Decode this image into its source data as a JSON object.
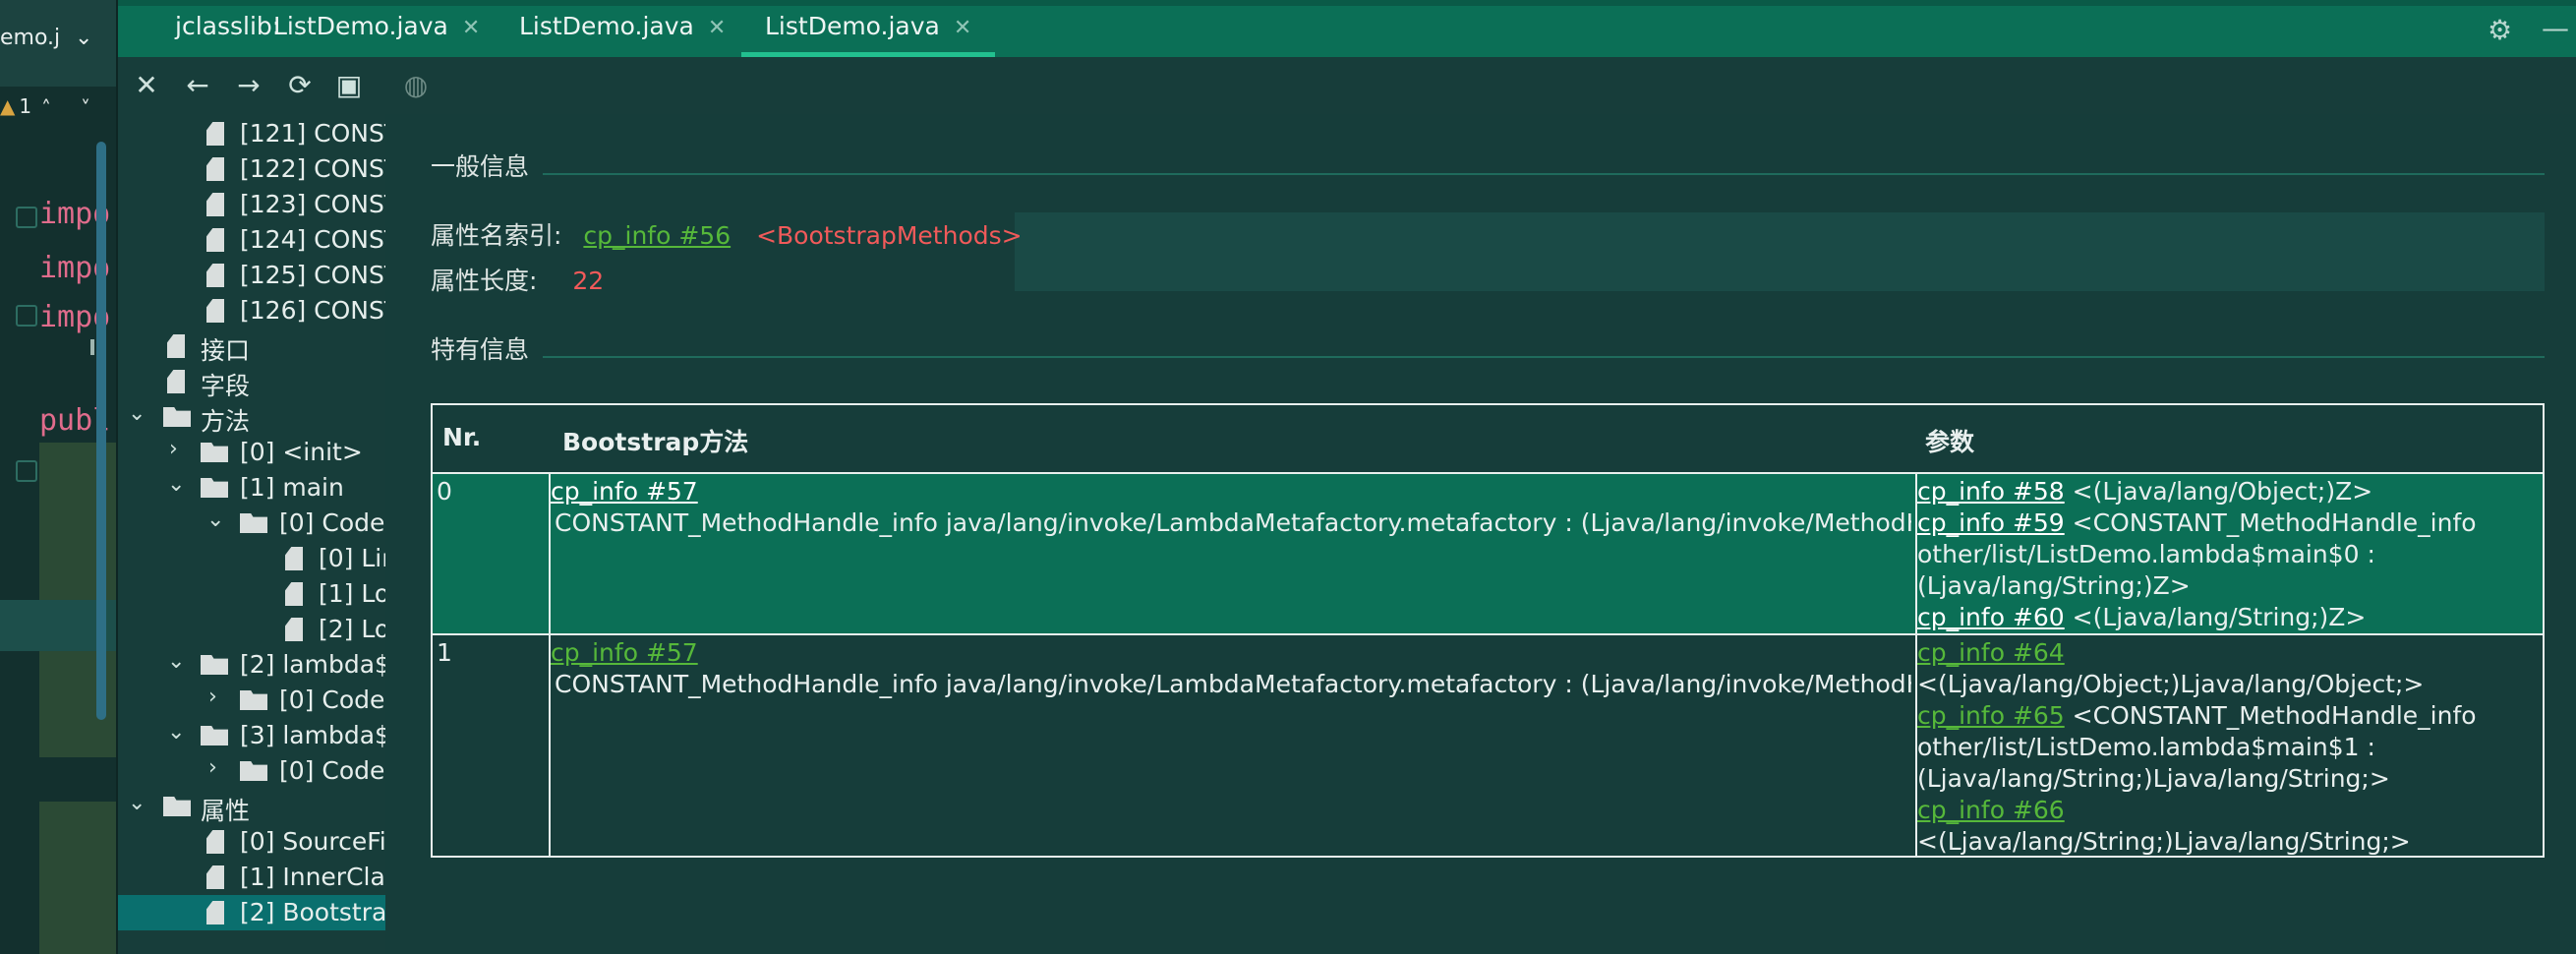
{
  "editor": {
    "file_tab": "emo.j",
    "warning_count": "1",
    "code_lines": [
      "impo",
      "impo",
      "impo",
      "publ"
    ]
  },
  "tabs": {
    "prefix": "jclasslib:",
    "items": [
      {
        "label": "ListDemo.java"
      },
      {
        "label": "ListDemo.java"
      },
      {
        "label": "ListDemo.java"
      }
    ]
  },
  "tree": {
    "items": [
      {
        "label": "[121] CONST"
      },
      {
        "label": "[122] CONST"
      },
      {
        "label": "[123] CONST"
      },
      {
        "label": "[124] CONST"
      },
      {
        "label": "[125] CONST"
      },
      {
        "label": "[126] CONST"
      },
      {
        "label": "接口"
      },
      {
        "label": "字段"
      },
      {
        "label": "方法"
      },
      {
        "label": "[0] <init>"
      },
      {
        "label": "[1] main"
      },
      {
        "label": "[0] Code"
      },
      {
        "label": "[0] Lin"
      },
      {
        "label": "[1] Lo"
      },
      {
        "label": "[2] Lo"
      },
      {
        "label": "[2] lambda$"
      },
      {
        "label": "[0] Code"
      },
      {
        "label": "[3] lambda$"
      },
      {
        "label": "[0] Code"
      },
      {
        "label": "属性"
      },
      {
        "label": "[0] SourceFi"
      },
      {
        "label": "[1] InnerClas"
      },
      {
        "label": "[2] Bootstra"
      }
    ]
  },
  "general": {
    "title": "一般信息",
    "name_index_label": "属性名索引:",
    "name_index_link": "cp_info #56",
    "name_index_value": "<BootstrapMethods>",
    "length_label": "属性长度:",
    "length_value": "22"
  },
  "specific": {
    "title": "特有信息",
    "headers": [
      "Nr.",
      "Bootstrap方法",
      "参数"
    ],
    "rows": [
      {
        "nr": "0",
        "method_link": "cp_info #57",
        "method_desc": "CONSTANT_MethodHandle_info java/lang/invoke/LambdaMetafactory.metafactory : (Ljava/lang/invoke/MethodHandles$Lookup;",
        "args": [
          {
            "link": "cp_info #58",
            "text": "<(Ljava/lang/Object;)Z>"
          },
          {
            "link": "cp_info #59",
            "text": "<CONSTANT_MethodHandle_info"
          },
          {
            "link": "",
            "text": "other/list/ListDemo.lambda$main$0 :"
          },
          {
            "link": "",
            "text": "(Ljava/lang/String;)Z>"
          },
          {
            "link": "cp_info #60",
            "text": "<(Ljava/lang/String;)Z>"
          }
        ]
      },
      {
        "nr": "1",
        "method_link": "cp_info #57",
        "method_desc": "CONSTANT_MethodHandle_info java/lang/invoke/LambdaMetafactory.metafactory : (Ljava/lang/invoke/MethodHandles$Lookup;",
        "args": [
          {
            "link": "cp_info #64",
            "text": ""
          },
          {
            "link": "",
            "text": "<(Ljava/lang/Object;)Ljava/lang/Object;>"
          },
          {
            "link": "cp_info #65",
            "text": "<CONSTANT_MethodHandle_info"
          },
          {
            "link": "",
            "text": "other/list/ListDemo.lambda$main$1 :"
          },
          {
            "link": "",
            "text": "(Ljava/lang/String;)Ljava/lang/String;>"
          },
          {
            "link": "cp_info #66",
            "text": ""
          },
          {
            "link": "",
            "text": "<(Ljava/lang/String;)Ljava/lang/String;>"
          }
        ]
      }
    ]
  },
  "colors": {
    "tabbar": "#0b6f56",
    "link": "#56b83a",
    "value_red": "#f15a5a",
    "selected_row": "#0b6f56"
  }
}
